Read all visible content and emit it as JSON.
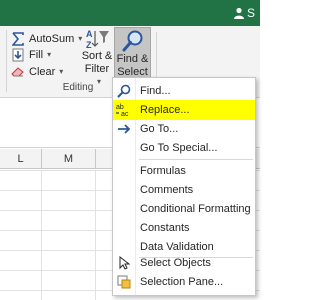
{
  "titlebar": {
    "user_initial": "S"
  },
  "ribbon": {
    "editing": {
      "autosum_label": "AutoSum",
      "fill_label": "Fill",
      "clear_label": "Clear",
      "sort_filter_line1": "Sort &",
      "sort_filter_line2": "Filter",
      "find_select_line1": "Find &",
      "find_select_line2": "Select",
      "group_label": "Editing"
    }
  },
  "sheet": {
    "columns": [
      "L",
      "M"
    ]
  },
  "find_select_menu": {
    "items": [
      {
        "label": "Find...",
        "icon": "magnifier-icon"
      },
      {
        "label": "Replace...",
        "icon": "replace-icon",
        "highlighted": true
      },
      {
        "label": "Go To...",
        "icon": "arrow-right-icon"
      },
      {
        "label": "Go To Special..."
      },
      {
        "label": "Formulas"
      },
      {
        "label": "Comments"
      },
      {
        "label": "Conditional Formatting"
      },
      {
        "label": "Constants"
      },
      {
        "label": "Data Validation"
      },
      {
        "label": "Select Objects",
        "icon": "pointer-icon"
      },
      {
        "label": "Selection Pane...",
        "icon": "selection-pane-icon"
      }
    ]
  },
  "colors": {
    "title_green": "#217346",
    "highlight": "#ffff00",
    "blue_icon": "#2b579a"
  }
}
